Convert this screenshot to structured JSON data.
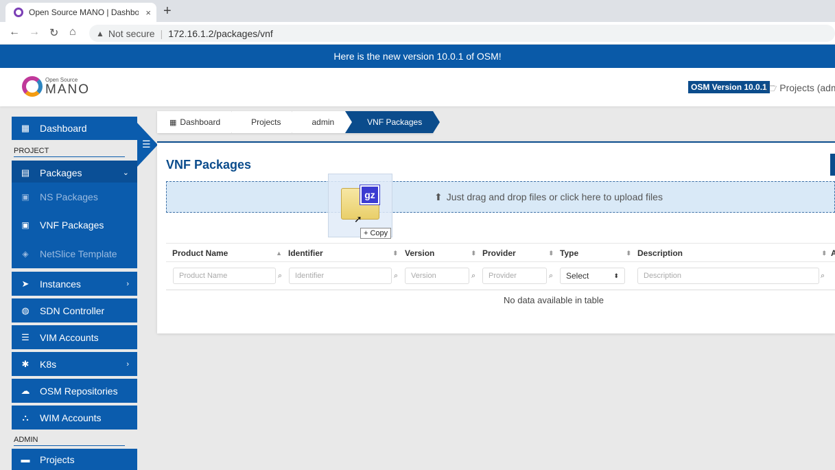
{
  "browser": {
    "tab_title": "Open Source MANO | Dashboard",
    "tab_close": "×",
    "new_tab": "+",
    "not_secure": "Not secure",
    "url": "172.16.1.2/packages/vnf"
  },
  "banner": {
    "text": "Here is the new version 10.0.1 of OSM!"
  },
  "header": {
    "logo_small": "Open Source",
    "logo_big": "MANO",
    "version_badge": "OSM Version 10.0.1",
    "projects_link": "Projects (admin)"
  },
  "sidebar": {
    "dashboard": "Dashboard",
    "project_section": "PROJECT",
    "packages": "Packages",
    "ns_packages": "NS Packages",
    "vnf_packages": "VNF Packages",
    "netslice_template": "NetSlice Template",
    "instances": "Instances",
    "sdn_controller": "SDN Controller",
    "vim_accounts": "VIM Accounts",
    "k8s": "K8s",
    "osm_repositories": "OSM Repositories",
    "wim_accounts": "WIM Accounts",
    "admin_section": "ADMIN",
    "projects": "Projects"
  },
  "breadcrumb": [
    "Dashboard",
    "Projects",
    "admin",
    "VNF Packages"
  ],
  "main": {
    "title": "VNF Packages",
    "dropzone_text": "Just drag and drop files or click here to upload files",
    "columns": [
      "Product Name",
      "Identifier",
      "Version",
      "Provider",
      "Type",
      "Description",
      "A"
    ],
    "filters": {
      "product_name": "Product Name",
      "identifier": "Identifier",
      "version": "Version",
      "provider": "Provider",
      "type_select": "Select",
      "description": "Description"
    },
    "empty_message": "No data available in table"
  },
  "drag": {
    "badge": "gz",
    "tooltip": "+ Copy"
  },
  "colors": {
    "primary": "#0b5cad",
    "banner": "#0a5aa8",
    "dropzone": "#d9e9f7"
  }
}
